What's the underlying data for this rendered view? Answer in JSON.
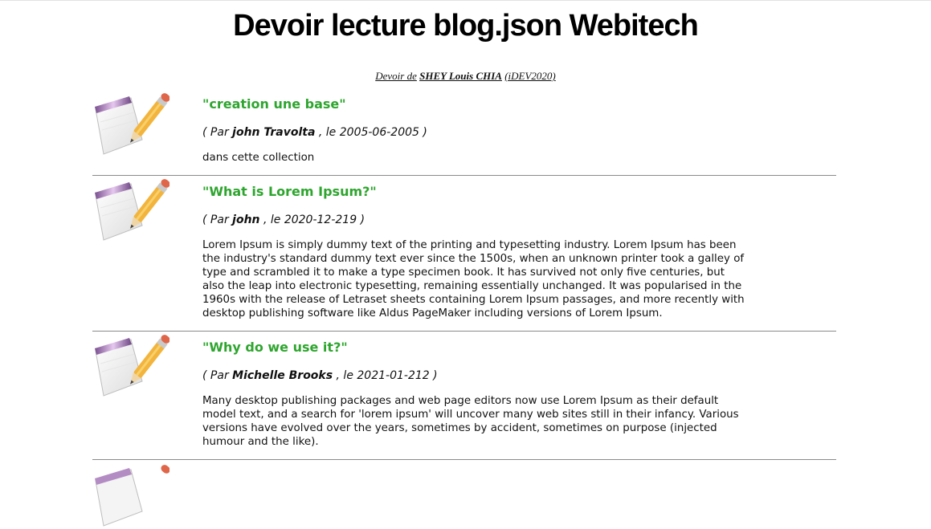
{
  "page": {
    "title": "Devoir lecture blog.json Webitech",
    "byline_prefix": "Devoir de",
    "byline_author": "SHEY Louis CHIA",
    "byline_class": "(iDEV2020)"
  },
  "meta_labels": {
    "open": "(",
    "par": "Par",
    "le": ", le",
    "close": ")"
  },
  "icons": {
    "post_icon": "notepad-pencil-icon"
  },
  "colors": {
    "title_green": "#2ea52e",
    "separator": "#8a8a8a"
  },
  "posts": [
    {
      "title": "\"creation une base\"",
      "author": "john Travolta",
      "date": "2005-06-2005",
      "content": "dans cette collection"
    },
    {
      "title": "\"What is Lorem Ipsum?\"",
      "author": "john",
      "date": "2020-12-219",
      "content": "Lorem Ipsum is simply dummy text of the printing and typesetting industry. Lorem Ipsum has been the industry's standard dummy text ever since the 1500s, when an unknown printer took a galley of type and scrambled it to make a type specimen book. It has survived not only five centuries, but also the leap into electronic typesetting, remaining essentially unchanged. It was popularised in the 1960s with the release of Letraset sheets containing Lorem Ipsum passages, and more recently with desktop publishing software like Aldus PageMaker including versions of Lorem Ipsum."
    },
    {
      "title": "\"Why do we use it?\"",
      "author": "Michelle Brooks",
      "date": "2021-01-212",
      "content": "Many desktop publishing packages and web page editors now use Lorem Ipsum as their default model text, and a search for 'lorem ipsum' will uncover many web sites still in their infancy. Various versions have evolved over the years, sometimes by accident, sometimes on purpose (injected humour and the like)."
    }
  ]
}
